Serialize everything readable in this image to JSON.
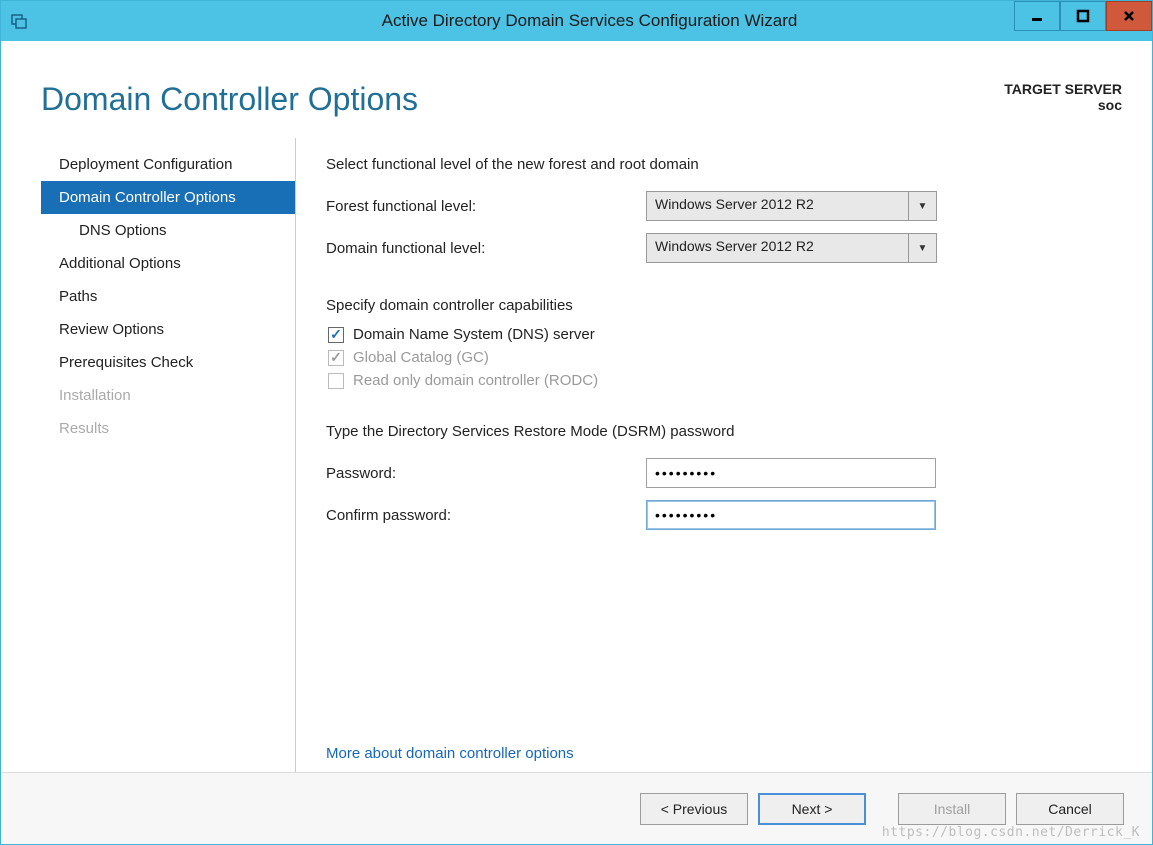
{
  "window": {
    "title": "Active Directory Domain Services Configuration Wizard"
  },
  "header": {
    "page_title": "Domain Controller Options",
    "target_label": "TARGET SERVER",
    "target_value": "soc"
  },
  "sidebar": {
    "items": [
      {
        "label": "Deployment Configuration",
        "indent": false,
        "selected": false,
        "disabled": false
      },
      {
        "label": "Domain Controller Options",
        "indent": false,
        "selected": true,
        "disabled": false
      },
      {
        "label": "DNS Options",
        "indent": true,
        "selected": false,
        "disabled": false
      },
      {
        "label": "Additional Options",
        "indent": false,
        "selected": false,
        "disabled": false
      },
      {
        "label": "Paths",
        "indent": false,
        "selected": false,
        "disabled": false
      },
      {
        "label": "Review Options",
        "indent": false,
        "selected": false,
        "disabled": false
      },
      {
        "label": "Prerequisites Check",
        "indent": false,
        "selected": false,
        "disabled": false
      },
      {
        "label": "Installation",
        "indent": false,
        "selected": false,
        "disabled": true
      },
      {
        "label": "Results",
        "indent": false,
        "selected": false,
        "disabled": true
      }
    ]
  },
  "content": {
    "functional_heading": "Select functional level of the new forest and root domain",
    "forest_label": "Forest functional level:",
    "forest_value": "Windows Server 2012 R2",
    "domain_label": "Domain functional level:",
    "domain_value": "Windows Server 2012 R2",
    "capabilities_heading": "Specify domain controller capabilities",
    "cap_dns": "Domain Name System (DNS) server",
    "cap_gc": "Global Catalog (GC)",
    "cap_rodc": "Read only domain controller (RODC)",
    "dsrm_heading": "Type the Directory Services Restore Mode (DSRM) password",
    "password_label": "Password:",
    "password_value": "•••••••••",
    "confirm_label": "Confirm password:",
    "confirm_value": "•••••••••",
    "more_link": "More about domain controller options"
  },
  "footer": {
    "previous": "< Previous",
    "next": "Next >",
    "install": "Install",
    "cancel": "Cancel"
  },
  "watermark": "https://blog.csdn.net/Derrick_K"
}
